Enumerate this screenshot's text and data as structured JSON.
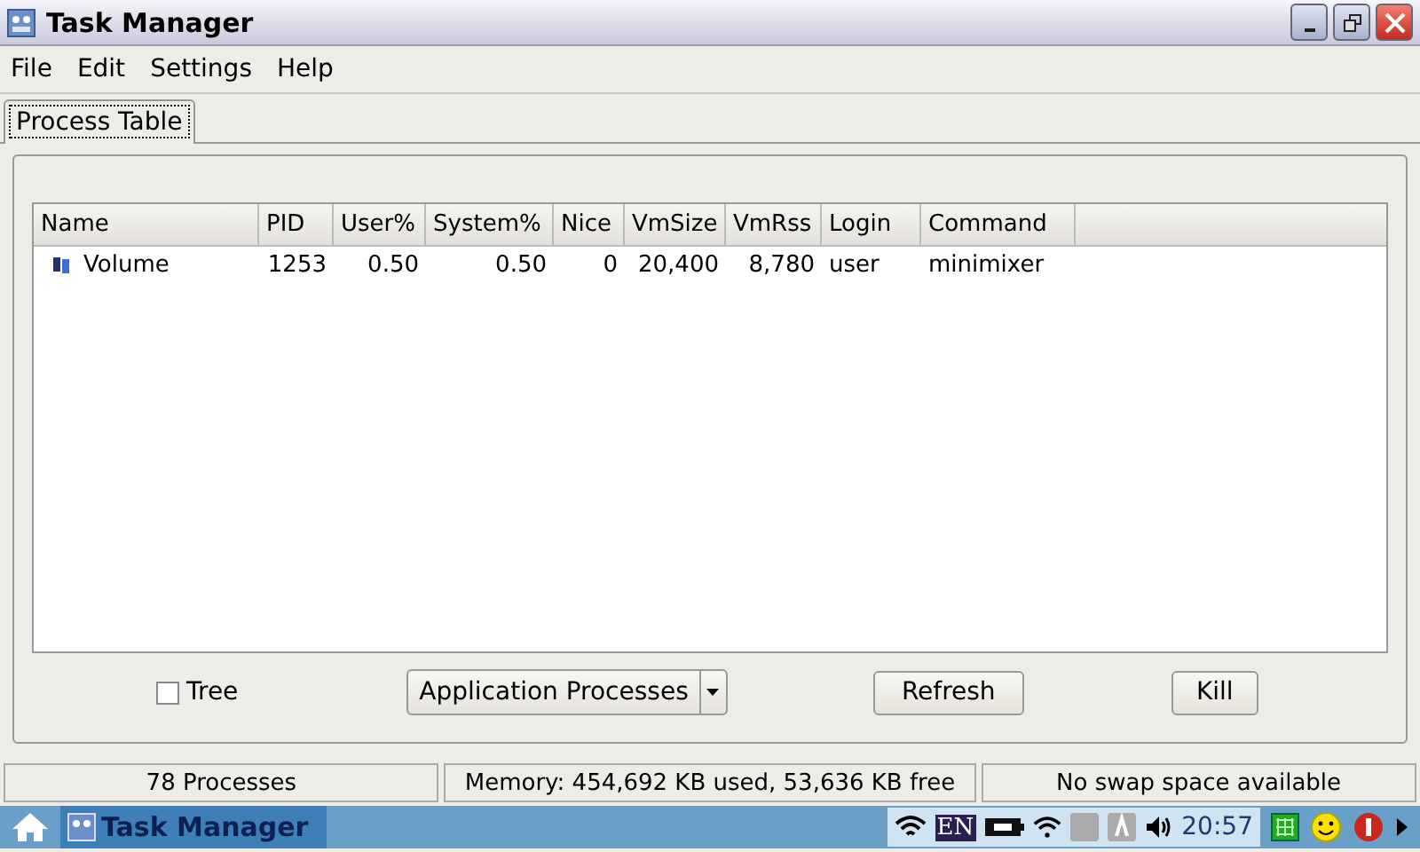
{
  "window": {
    "title": "Task Manager"
  },
  "menu": [
    "File",
    "Edit",
    "Settings",
    "Help"
  ],
  "tabs": [
    {
      "label": "Process Table",
      "selected": true
    }
  ],
  "table": {
    "columns": [
      "Name",
      "PID",
      "User%",
      "System%",
      "Nice",
      "VmSize",
      "VmRss",
      "Login",
      "Command"
    ],
    "rows": [
      {
        "selected": false,
        "cells": [
          "Volume",
          "1253",
          "0.50",
          "0.50",
          "0",
          "20,400",
          "8,780",
          "user",
          "minimixer"
        ]
      }
    ]
  },
  "tree": {
    "label": "Tree",
    "checked": false
  },
  "filter": {
    "value": "Application Processes"
  },
  "buttons": [
    "Refresh",
    "Kill"
  ],
  "status_bar": [
    "78 Processes",
    "Memory: 454,692 KB used, 53,636 KB free",
    "No swap space available"
  ],
  "taskbar": {
    "task": "Task Manager",
    "keyboard": "EN",
    "clock": "20:57"
  }
}
